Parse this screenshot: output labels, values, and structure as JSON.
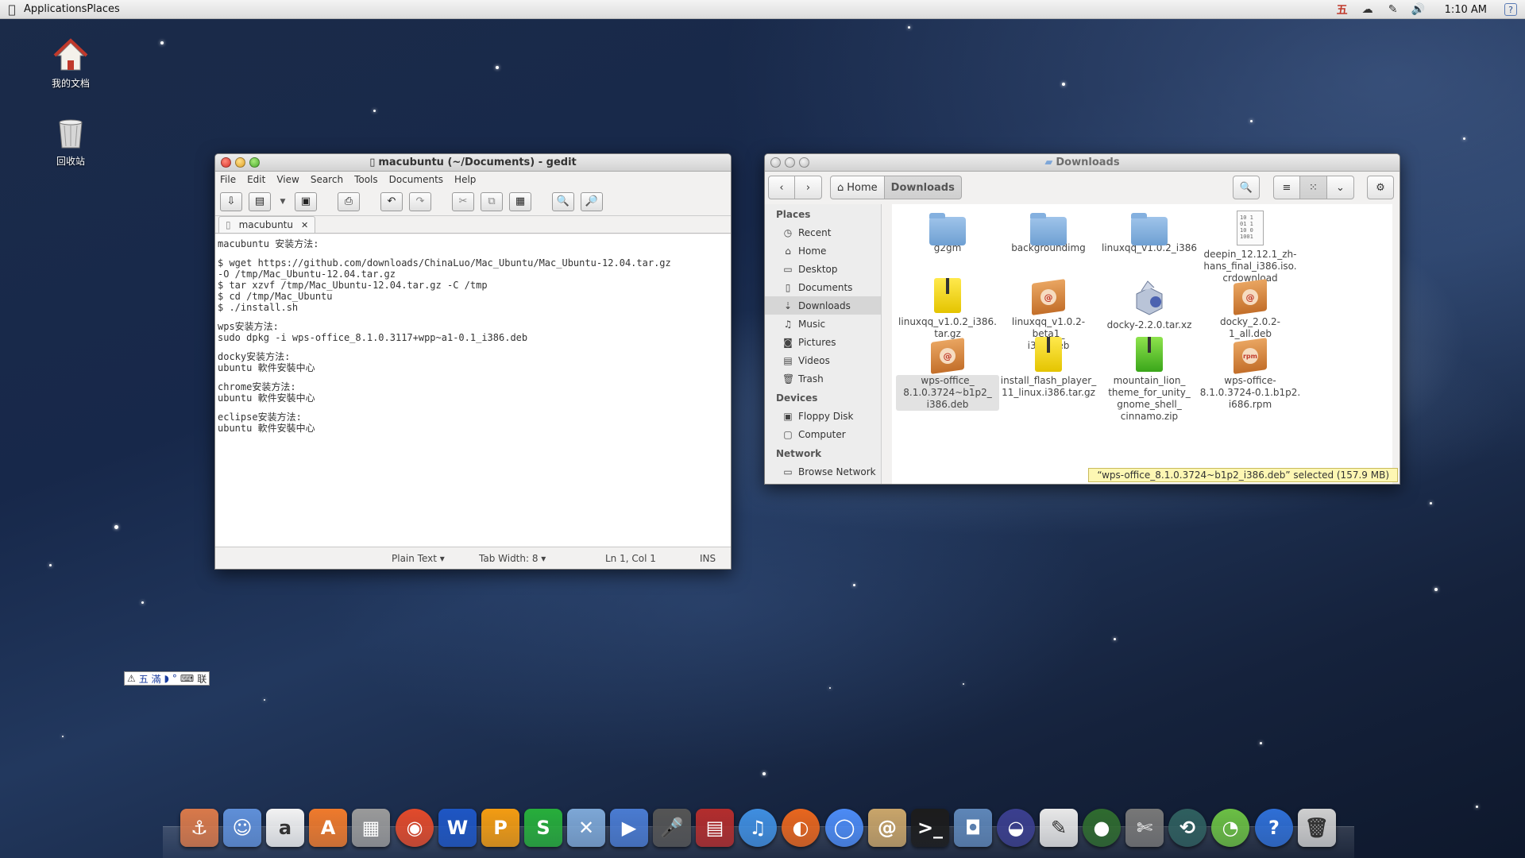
{
  "top_panel": {
    "menu_applications": "Applications",
    "menu_places": "Places",
    "clock": "1:10 AM",
    "ime_indicator": "五",
    "tray_icons": [
      "wu-ime-icon",
      "weather-cloud-icon",
      "brush-icon",
      "volume-icon",
      "help-icon"
    ]
  },
  "desktop": {
    "icons": [
      {
        "label": "我的文档",
        "icon": "home-folder-icon"
      },
      {
        "label": "回收站",
        "icon": "trash-icon"
      }
    ]
  },
  "gedit": {
    "title": "macubuntu (~/Documents) - gedit",
    "menu": [
      "File",
      "Edit",
      "View",
      "Search",
      "Tools",
      "Documents",
      "Help"
    ],
    "tab_label": "macubuntu",
    "lines": [
      "macubuntu 安装方法:",
      "",
      "$ wget https://github.com/downloads/ChinaLuo/Mac_Ubuntu/Mac_Ubuntu-12.04.tar.gz",
      "-O /tmp/Mac_Ubuntu-12.04.tar.gz",
      "$ tar xzvf /tmp/Mac_Ubuntu-12.04.tar.gz -C /tmp",
      "$ cd /tmp/Mac_Ubuntu",
      "$ ./install.sh",
      "",
      "wps安装方法:",
      "sudo dpkg -i wps-office_8.1.0.3117+wpp~a1-0.1_i386.deb",
      "",
      "docky安装方法:",
      "ubuntu 軟件安裝中心",
      "",
      "chrome安装方法:",
      "ubuntu 軟件安裝中心",
      "",
      "eclipse安装方法:",
      "ubuntu 軟件安裝中心"
    ],
    "status": {
      "language": "Plain Text",
      "tab_width": "Tab Width:  8",
      "position": "Ln 1, Col 1",
      "mode": "INS"
    }
  },
  "nautilus": {
    "title": "Downloads",
    "path_home": "Home",
    "path_current": "Downloads",
    "sidebar": {
      "places_heading": "Places",
      "places": [
        "Recent",
        "Home",
        "Desktop",
        "Documents",
        "Downloads",
        "Music",
        "Pictures",
        "Videos",
        "Trash"
      ],
      "devices_heading": "Devices",
      "devices": [
        "Floppy Disk",
        "Computer"
      ],
      "network_heading": "Network",
      "network": [
        "Browse Network"
      ]
    },
    "files": [
      {
        "name": "g2gm",
        "type": "folder"
      },
      {
        "name": "backgroundimg",
        "type": "folder"
      },
      {
        "name": "linuxqq_v1.0.2_i386",
        "type": "folder"
      },
      {
        "name": "deepin_12.12.1_zh-hans_final_i386.iso.crdownload",
        "type": "doc"
      },
      {
        "name": "linuxqq_v1.0.2_i386.tar.gz",
        "type": "archive"
      },
      {
        "name": "linuxqq_v1.0.2-beta1_i386.deb",
        "type": "pkg"
      },
      {
        "name": "docky-2.2.0.tar.xz",
        "type": "docky"
      },
      {
        "name": "docky_2.0.2-1_all.deb",
        "type": "pkg"
      },
      {
        "name": "wps-office_8.1.0.3724~b1p2_i386.deb",
        "type": "pkg"
      },
      {
        "name": "install_flash_player_11_linux.i386.tar.gz",
        "type": "archive"
      },
      {
        "name": "mountain_lion_theme_for_unity_gnome_shell_cinnamo.zip",
        "type": "zip"
      },
      {
        "name": "wps-office-8.1.0.3724-0.1.b1p2.i686.rpm",
        "type": "rpm"
      }
    ],
    "file_labels": [
      [
        "g2gm"
      ],
      [
        "backgroundimg"
      ],
      [
        "linuxqq_v1.0.2_i386"
      ],
      [
        "deepin_12.12.1_zh-",
        "hans_final_i386.iso.",
        "crdownload"
      ],
      [
        "linuxqq_v1.0.2_i386.",
        "tar.gz"
      ],
      [
        "linuxqq_v1.0.2-beta1_",
        "i386.deb"
      ],
      [
        "docky-2.2.0.tar.xz"
      ],
      [
        "docky_2.0.2-1_all.deb"
      ],
      [
        "wps-office_",
        "8.1.0.3724~b1p2_",
        "i386.deb"
      ],
      [
        "install_flash_player_",
        "11_linux.i386.tar.gz"
      ],
      [
        "mountain_lion_",
        "theme_for_unity_",
        "gnome_shell_",
        "cinnamo.zip"
      ],
      [
        "wps-office-",
        "8.1.0.3724-0.1.b1p2.",
        "i686.rpm"
      ]
    ],
    "status": "“wps-office_8.1.0.3724~b1p2_i386.deb” selected  (157.9 MB)"
  },
  "ime_bar": {
    "text": "五 滿",
    "suffix": "联"
  },
  "dock": {
    "items": [
      {
        "name": "anchor-icon",
        "color": "#d9794a",
        "glyph": "⚓"
      },
      {
        "name": "finder-icon",
        "color": "#5f8fd8",
        "glyph": "☺"
      },
      {
        "name": "amazon-icon",
        "color": "#f2f2f2",
        "glyph": "a"
      },
      {
        "name": "software-center-icon",
        "color": "#ef7a2c",
        "glyph": "A"
      },
      {
        "name": "calculator-icon",
        "color": "#9a9a9a",
        "glyph": "▦"
      },
      {
        "name": "burner-icon",
        "color": "#e24a2b",
        "glyph": "◉"
      },
      {
        "name": "wps-writer-icon",
        "color": "#1e56c4",
        "glyph": "W"
      },
      {
        "name": "wps-presentation-icon",
        "color": "#f39c12",
        "glyph": "P"
      },
      {
        "name": "wps-spreadsheet-icon",
        "color": "#27ae3b",
        "glyph": "S"
      },
      {
        "name": "applications-folder-icon",
        "color": "#7da7d6",
        "glyph": "✕"
      },
      {
        "name": "quicktime-icon",
        "color": "#4a7bd1",
        "glyph": "▶"
      },
      {
        "name": "microphone-icon",
        "color": "#555555",
        "glyph": "🎤"
      },
      {
        "name": "photo-booth-icon",
        "color": "#b32d2d",
        "glyph": "▤"
      },
      {
        "name": "itunes-icon",
        "color": "#3f8ee0",
        "glyph": "♫"
      },
      {
        "name": "firefox-icon",
        "color": "#e8661e",
        "glyph": "◐"
      },
      {
        "name": "chrome-icon",
        "color": "#4c8bf5",
        "glyph": "◯"
      },
      {
        "name": "contacts-icon",
        "color": "#c9a56a",
        "glyph": "@"
      },
      {
        "name": "terminal-icon",
        "color": "#1c1c1c",
        "glyph": ">_"
      },
      {
        "name": "screenshot-icon",
        "color": "#5e86b8",
        "glyph": "◘"
      },
      {
        "name": "eclipse-icon",
        "color": "#3b3f8f",
        "glyph": "◒"
      },
      {
        "name": "text-editor-icon",
        "color": "#e8e8e8",
        "glyph": "✎"
      },
      {
        "name": "network-globe-icon",
        "color": "#2f6b2f",
        "glyph": "●"
      },
      {
        "name": "preview-icon",
        "color": "#777777",
        "glyph": "✄"
      },
      {
        "name": "time-machine-icon",
        "color": "#2f5f5f",
        "glyph": "⟲"
      },
      {
        "name": "clock-icon",
        "color": "#6bbf44",
        "glyph": "◔"
      },
      {
        "name": "help-icon",
        "color": "#2f6fd6",
        "glyph": "?"
      },
      {
        "name": "trash-icon",
        "color": "#cfcfcf",
        "glyph": "🗑"
      }
    ]
  }
}
